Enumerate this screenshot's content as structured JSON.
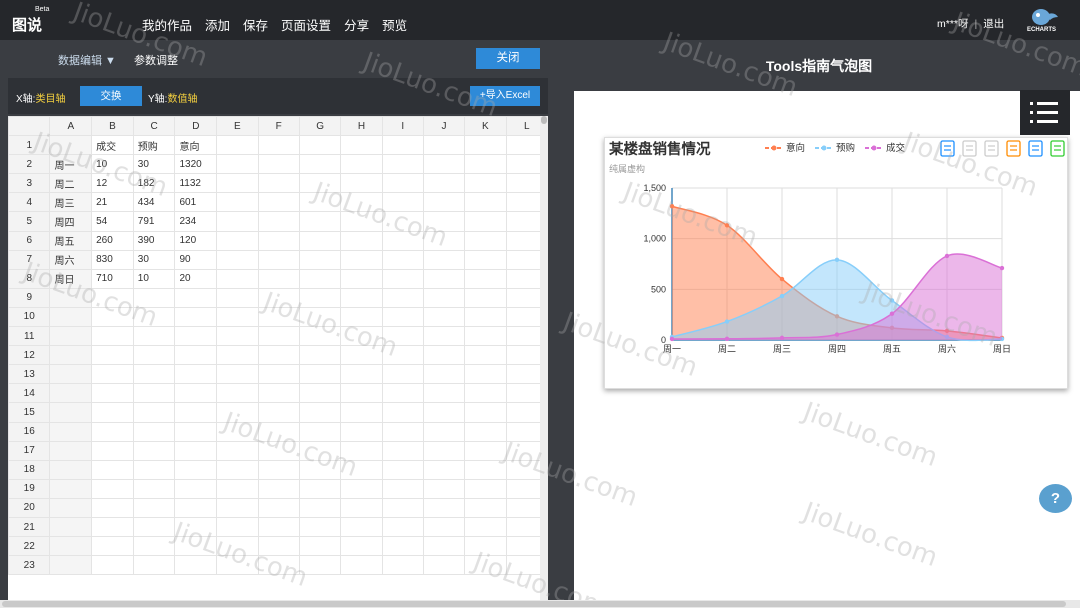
{
  "app": {
    "logo": "图说",
    "beta": "Beta",
    "echarts_label": "ECHARTS"
  },
  "nav": [
    "我的作品",
    "添加",
    "保存",
    "页面设置",
    "分享",
    "预览"
  ],
  "user": {
    "name": "m***呀",
    "separator": "|",
    "logout": "退出"
  },
  "editor": {
    "tab_data": "数据编辑 ▼",
    "tab_params": "参数调整",
    "close": "关闭",
    "x_axis_label": "X轴:",
    "x_axis_value": "类目轴",
    "swap": "交换",
    "y_axis_label": "Y轴:",
    "y_axis_value": "数值轴",
    "import_excel": "+导入Excel"
  },
  "sheet": {
    "columns": [
      "A",
      "B",
      "C",
      "D",
      "E",
      "F",
      "G",
      "H",
      "I",
      "J",
      "K",
      "L"
    ],
    "rows": [
      [
        "",
        "成交",
        "预购",
        "意向"
      ],
      [
        "周一",
        "10",
        "30",
        "1320"
      ],
      [
        "周二",
        "12",
        "182",
        "1132"
      ],
      [
        "周三",
        "21",
        "434",
        "601"
      ],
      [
        "周四",
        "54",
        "791",
        "234"
      ],
      [
        "周五",
        "260",
        "390",
        "120"
      ],
      [
        "周六",
        "830",
        "30",
        "90"
      ],
      [
        "周日",
        "710",
        "10",
        "20"
      ]
    ],
    "total_rows": 23
  },
  "preview": {
    "title": "Tools指南气泡图",
    "help": "?"
  },
  "watermark_text": "JioLuo.com",
  "colors": {
    "accent": "#2e8ad8",
    "yixiang": "#ff7f50",
    "yugou": "#87cefa",
    "chengjiao": "#da70d6"
  },
  "toolbox_icons": [
    "mark-icon",
    "mark-undo-icon",
    "mark-clear-icon",
    "data-view-icon",
    "restore-icon",
    "save-image-icon"
  ],
  "chart_data": {
    "type": "area",
    "title": "某楼盘销售情况",
    "subtitle": "纯属虚构",
    "categories": [
      "周一",
      "周二",
      "周三",
      "周四",
      "周五",
      "周六",
      "周日"
    ],
    "series": [
      {
        "name": "意向",
        "values": [
          1320,
          1132,
          601,
          234,
          120,
          90,
          20
        ],
        "color": "#ff7f50"
      },
      {
        "name": "预购",
        "values": [
          30,
          182,
          434,
          791,
          390,
          30,
          10
        ],
        "color": "#87cefa"
      },
      {
        "name": "成交",
        "values": [
          10,
          12,
          21,
          54,
          260,
          830,
          710
        ],
        "color": "#da70d6"
      }
    ],
    "yticks": [
      0,
      500,
      1000,
      1500
    ],
    "yticks_labels": [
      "0",
      "500",
      "1,000",
      "1,500"
    ],
    "ylim": [
      0,
      1500
    ],
    "legend_position": "top",
    "grid": true
  }
}
